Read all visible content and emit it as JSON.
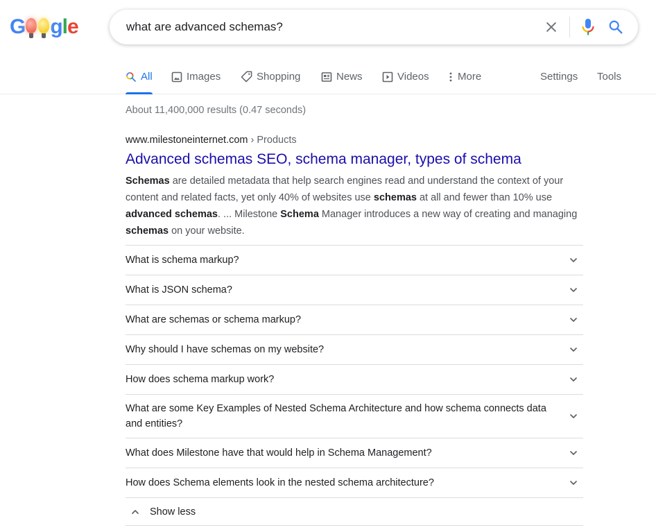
{
  "logo": {
    "text": "Google",
    "letters": [
      {
        "ch": "G",
        "color": "#4285f4"
      },
      {
        "ch": "bulb",
        "color": "#ef6a5a"
      },
      {
        "ch": "bulb",
        "color": "#f7cf3a"
      },
      {
        "ch": "g",
        "color": "#4285f4"
      },
      {
        "ch": "l",
        "color": "#34a853"
      },
      {
        "ch": "e",
        "color": "#ea4335"
      }
    ]
  },
  "search": {
    "query": "what are advanced schemas?",
    "clear_icon": "close-icon",
    "voice_icon": "microphone-icon",
    "search_icon": "search-icon"
  },
  "tabs": [
    {
      "label": "All",
      "icon": "search-icon",
      "active": true
    },
    {
      "label": "Images",
      "icon": "image-icon",
      "active": false
    },
    {
      "label": "Shopping",
      "icon": "tag-icon",
      "active": false
    },
    {
      "label": "News",
      "icon": "newspaper-icon",
      "active": false
    },
    {
      "label": "Videos",
      "icon": "play-icon",
      "active": false
    },
    {
      "label": "More",
      "icon": "more-vert-icon",
      "active": false
    }
  ],
  "tools": {
    "settings": "Settings",
    "tools": "Tools"
  },
  "stats": "About 11,400,000 results (0.47 seconds)",
  "result": {
    "domain": "www.milestoneinternet.com",
    "breadcrumb": " › Products",
    "title": "Advanced schemas SEO, schema manager, types of schema",
    "snippet": [
      {
        "t": "Schemas",
        "b": true
      },
      {
        "t": " are detailed metadata that help search engines read and understand the context of your content and related facts, yet only 40% of websites use ",
        "b": false
      },
      {
        "t": "schemas",
        "b": true
      },
      {
        "t": " at all and fewer than 10% use ",
        "b": false
      },
      {
        "t": "advanced schemas",
        "b": true
      },
      {
        "t": ". ... Milestone ",
        "b": false
      },
      {
        "t": "Schema",
        "b": true
      },
      {
        "t": " Manager introduces a new way of creating and managing ",
        "b": false
      },
      {
        "t": "schemas",
        "b": true
      },
      {
        "t": " on your website.",
        "b": false
      }
    ]
  },
  "faq": [
    "What is schema markup?",
    "What is JSON schema?",
    "What are schemas or schema markup?",
    "Why should I have schemas on my website?",
    "How does schema markup work?",
    "What are some Key Examples of Nested Schema Architecture and how schema connects data and entities?",
    "What does Milestone have that would help in Schema Management?",
    "How does Schema elements look in the nested schema architecture?"
  ],
  "show_less": "Show less"
}
